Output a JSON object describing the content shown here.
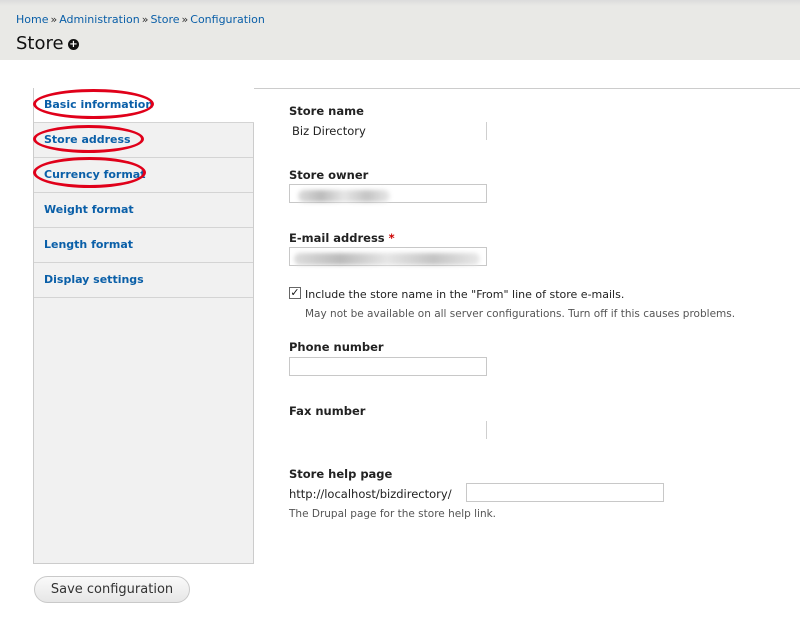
{
  "breadcrumb": {
    "home": "Home",
    "sep": "»",
    "administration": "Administration",
    "store": "Store",
    "configuration": "Configuration"
  },
  "page": {
    "title": "Store",
    "add_icon": "plus-circle-icon"
  },
  "tabs": [
    {
      "label": "Basic information",
      "active": true
    },
    {
      "label": "Store address"
    },
    {
      "label": "Currency format"
    },
    {
      "label": "Weight format"
    },
    {
      "label": "Length format"
    },
    {
      "label": "Display settings"
    }
  ],
  "form": {
    "store_name": {
      "label": "Store name",
      "value": "Biz Directory"
    },
    "store_owner": {
      "label": "Store owner"
    },
    "email": {
      "label": "E-mail address",
      "required": "*"
    },
    "from_line": {
      "checked": true,
      "label": "Include the store name in the \"From\" line of store e-mails.",
      "description": "May not be available on all server configurations. Turn off if this causes problems."
    },
    "phone": {
      "label": "Phone number"
    },
    "fax": {
      "label": "Fax number"
    },
    "help_page": {
      "label": "Store help page",
      "prefix": "http://localhost/bizdirectory/",
      "description": "The Drupal page for the store help link."
    }
  },
  "actions": {
    "save_label": "Save configuration"
  },
  "colors": {
    "link": "#0a5fa8",
    "annotation_ring": "#e0001a",
    "required": "#cc0000"
  }
}
